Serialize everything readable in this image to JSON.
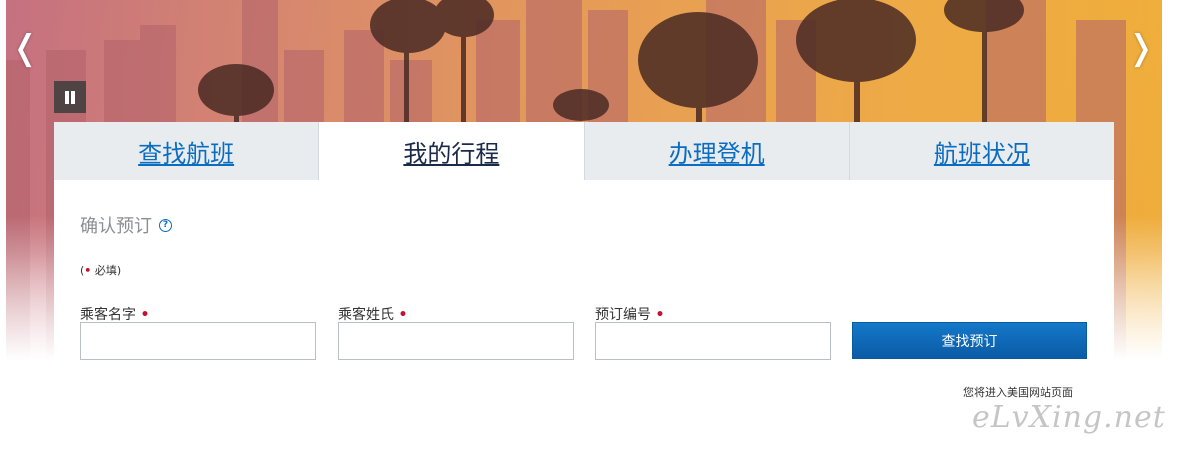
{
  "carousel": {
    "prev_glyph": "❬",
    "next_glyph": "❭"
  },
  "tabs": [
    {
      "label": "查找航班",
      "active": false
    },
    {
      "label": "我的行程",
      "active": true
    },
    {
      "label": "办理登机",
      "active": false
    },
    {
      "label": "航班状况",
      "active": false
    }
  ],
  "form": {
    "title": "确认预订",
    "help_glyph": "?",
    "required_note_open": "(",
    "required_note_dot": "•",
    "required_note_text": " 必填)",
    "fields": [
      {
        "label": "乘客名字",
        "value": ""
      },
      {
        "label": "乘客姓氏",
        "value": ""
      },
      {
        "label": "预订编号",
        "value": ""
      }
    ],
    "required_marker": "•",
    "submit_label": "查找预订"
  },
  "footer_note": "您将进入美国网站页面",
  "watermark": "eLvXing.net",
  "colors": {
    "accent_blue": "#0a6dc2",
    "button_blue": "#1470c0",
    "required_red": "#c8102e",
    "tab_bg": "#e8ecef"
  }
}
